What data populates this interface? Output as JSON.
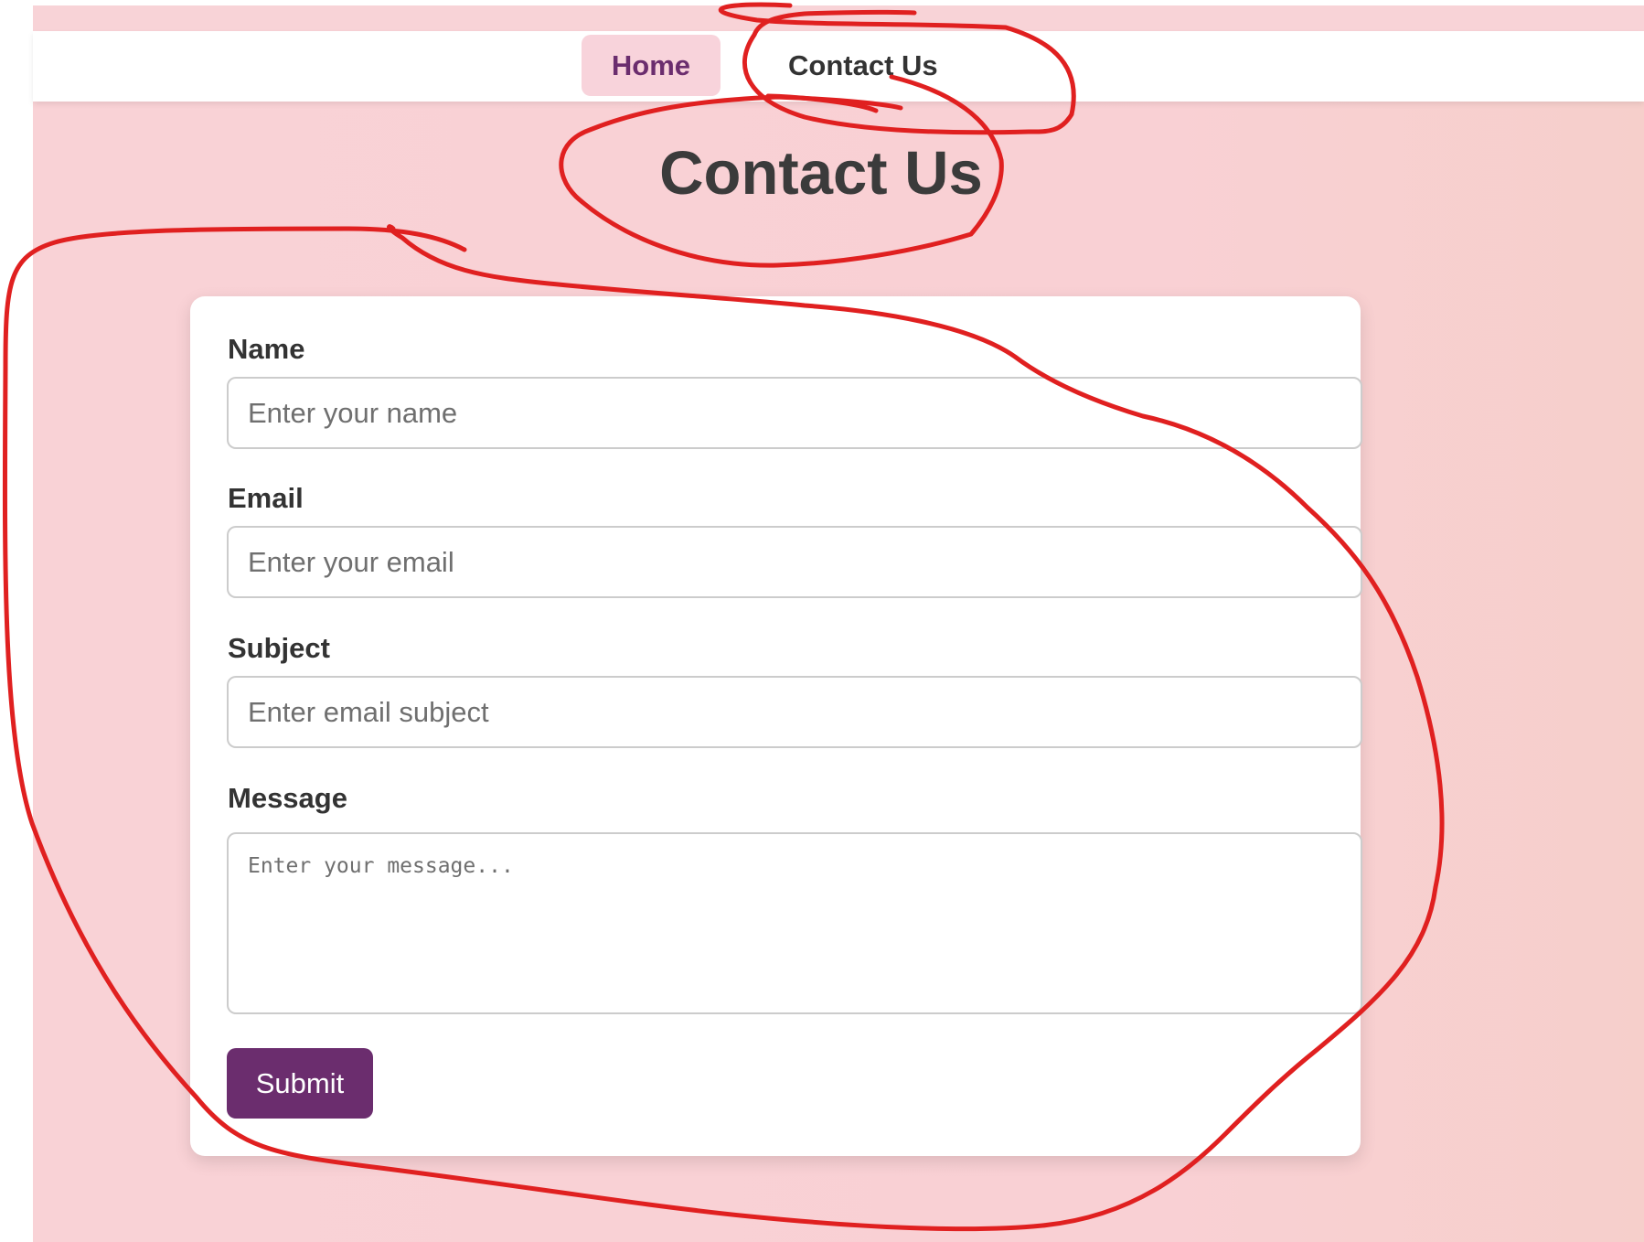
{
  "nav": {
    "items": [
      {
        "label": "Home",
        "active": true
      },
      {
        "label": "Contact Us",
        "active": false
      }
    ]
  },
  "page": {
    "title": "Contact Us"
  },
  "form": {
    "name": {
      "label": "Name",
      "placeholder": "Enter your name",
      "value": ""
    },
    "email": {
      "label": "Email",
      "placeholder": "Enter your email",
      "value": ""
    },
    "subject": {
      "label": "Subject",
      "placeholder": "Enter email subject",
      "value": ""
    },
    "message": {
      "label": "Message",
      "placeholder": "Enter your message...",
      "value": ""
    },
    "submit_label": "Submit"
  },
  "colors": {
    "accent": "#6b2d6e",
    "background": "#f9d2d6",
    "annotation": "#e02020"
  }
}
